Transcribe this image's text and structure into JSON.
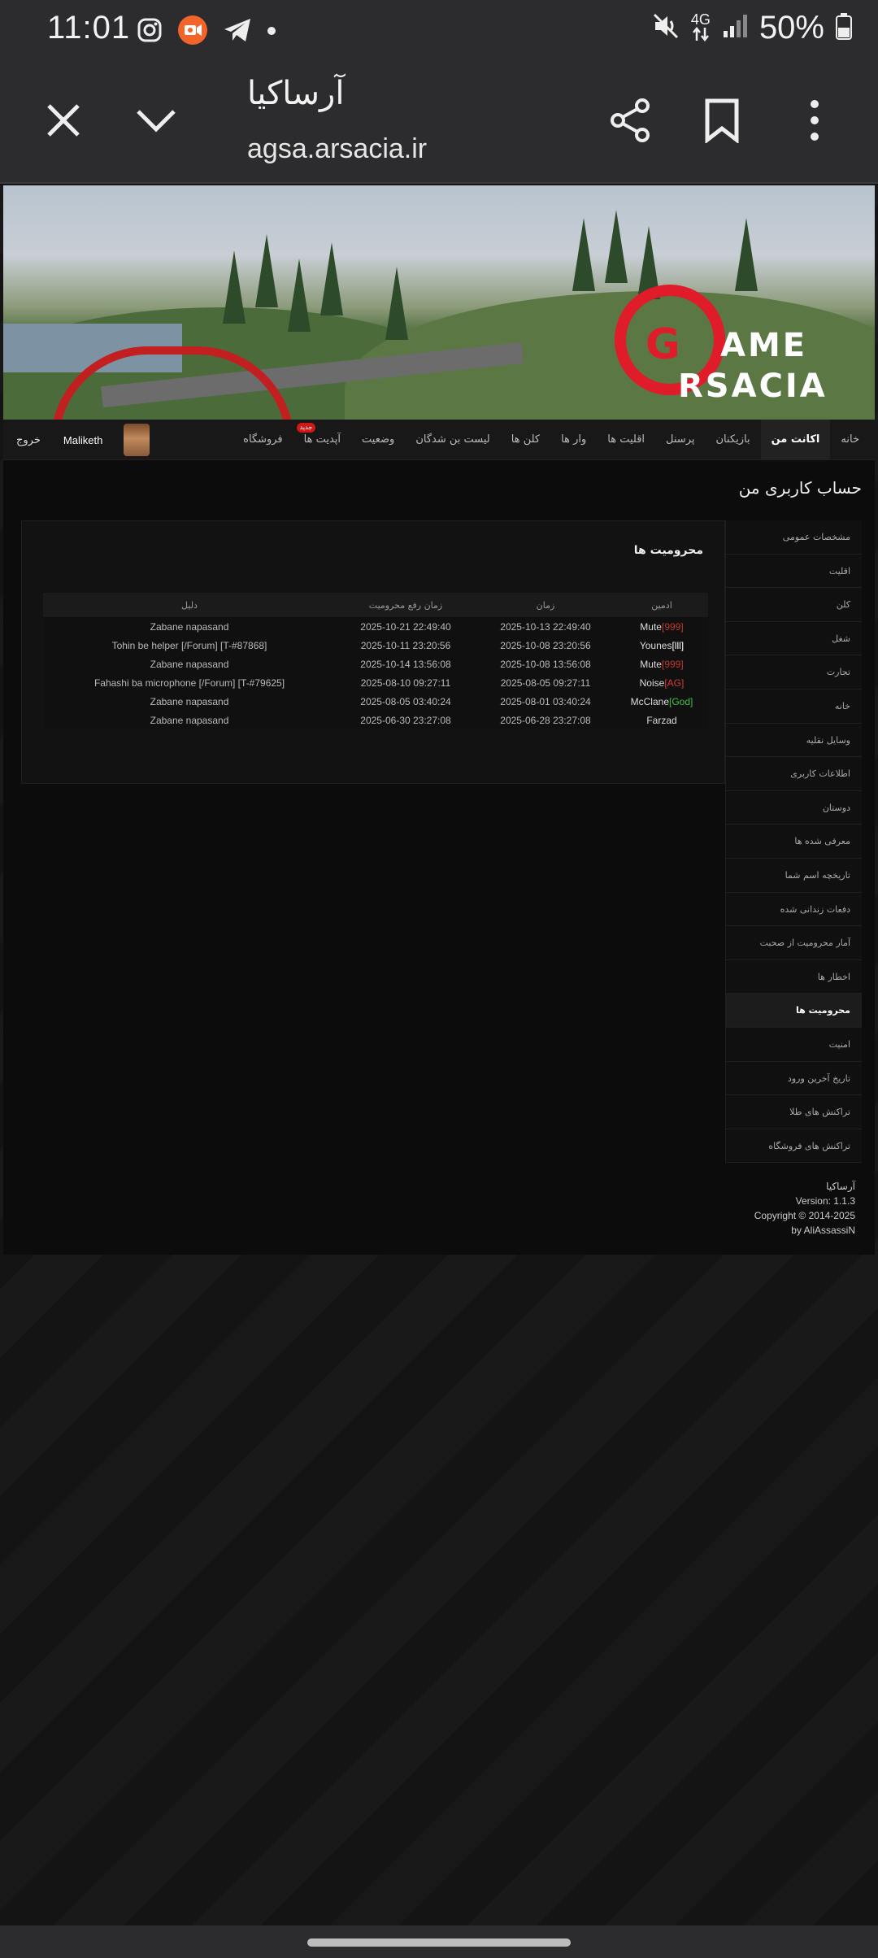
{
  "status": {
    "time": "11:01",
    "battery": "50%",
    "network": "4G"
  },
  "browser": {
    "title": "آرساکیا",
    "url": "agsa.arsacia.ir"
  },
  "banner": {
    "logo_line1": "AME",
    "logo_line2": "RSACIA",
    "logo_g": "G"
  },
  "nav": {
    "items": [
      {
        "label": "خانه",
        "active": false
      },
      {
        "label": "اکانت من",
        "active": true
      },
      {
        "label": "بازیکنان",
        "active": false
      },
      {
        "label": "پرسنل",
        "active": false
      },
      {
        "label": "اقلیت ها",
        "active": false
      },
      {
        "label": "وار ها",
        "active": false
      },
      {
        "label": "کلن ها",
        "active": false
      },
      {
        "label": "لیست بن شدگان",
        "active": false
      },
      {
        "label": "وضعیت",
        "active": false
      },
      {
        "label": "آپدیت ها",
        "active": false,
        "badge": "جدید"
      },
      {
        "label": "فروشگاه",
        "active": false
      }
    ],
    "username": "Maliketh",
    "logout": "خروج"
  },
  "page": {
    "heading": "حساب کاربری من"
  },
  "sidebar": {
    "items": [
      "مشخصات عمومی",
      "اقلیت",
      "کلن",
      "شغل",
      "تجارت",
      "خانه",
      "وسایل نقلیه",
      "اطلاعات کاربری",
      "دوستان",
      "معرفی شده ها",
      "تاریخچه اسم شما",
      "دفعات زندانی شده",
      "آمار محرومیت از صحبت",
      "اخطار ها",
      "محرومیت ها",
      "امنیت",
      "تاریخ آخرین ورود",
      "تراکنش های طلا",
      "تراکنش های فروشگاه"
    ],
    "active_index": 14
  },
  "bans": {
    "title": "محرومیت ها",
    "headers": {
      "admin": "ادمین",
      "time": "زمان",
      "unban": "زمان رفع محرومیت",
      "reason": "دلیل"
    },
    "rows": [
      {
        "tag": "[999]",
        "tag_color": "#c0392b",
        "name": "Mute",
        "time": "2025-10-13 22:49:40",
        "unban": "2025-10-21 22:49:40",
        "reason": "Zabane napasand"
      },
      {
        "tag": "[lll]",
        "tag_color": "#ffffff",
        "name": "Younes",
        "time": "2025-10-08 23:20:56",
        "unban": "2025-10-11 23:20:56",
        "reason": "Tohin be helper [/Forum] [T-#87868]"
      },
      {
        "tag": "[999]",
        "tag_color": "#c0392b",
        "name": "Mute",
        "time": "2025-10-08 13:56:08",
        "unban": "2025-10-14 13:56:08",
        "reason": "Zabane napasand"
      },
      {
        "tag": "[AG]",
        "tag_color": "#d23b3b",
        "name": "Noise",
        "time": "2025-08-05 09:27:11",
        "unban": "2025-08-10 09:27:11",
        "reason": "Fahashi ba microphone [/Forum] [T-#79625]"
      },
      {
        "tag": "[God]",
        "tag_color": "#3ec23e",
        "name": "McClane",
        "time": "2025-08-01 03:40:24",
        "unban": "2025-08-05 03:40:24",
        "reason": "Zabane napasand"
      },
      {
        "tag": "",
        "tag_color": "#ffffff",
        "name": "Farzad",
        "time": "2025-06-28 23:27:08",
        "unban": "2025-06-30 23:27:08",
        "reason": "Zabane napasand"
      }
    ]
  },
  "footer": {
    "site": "آرساکیا",
    "version": "Version: 1.1.3",
    "copyright": "Copyright © 2014-2025",
    "author": "by AliAssassiN"
  }
}
